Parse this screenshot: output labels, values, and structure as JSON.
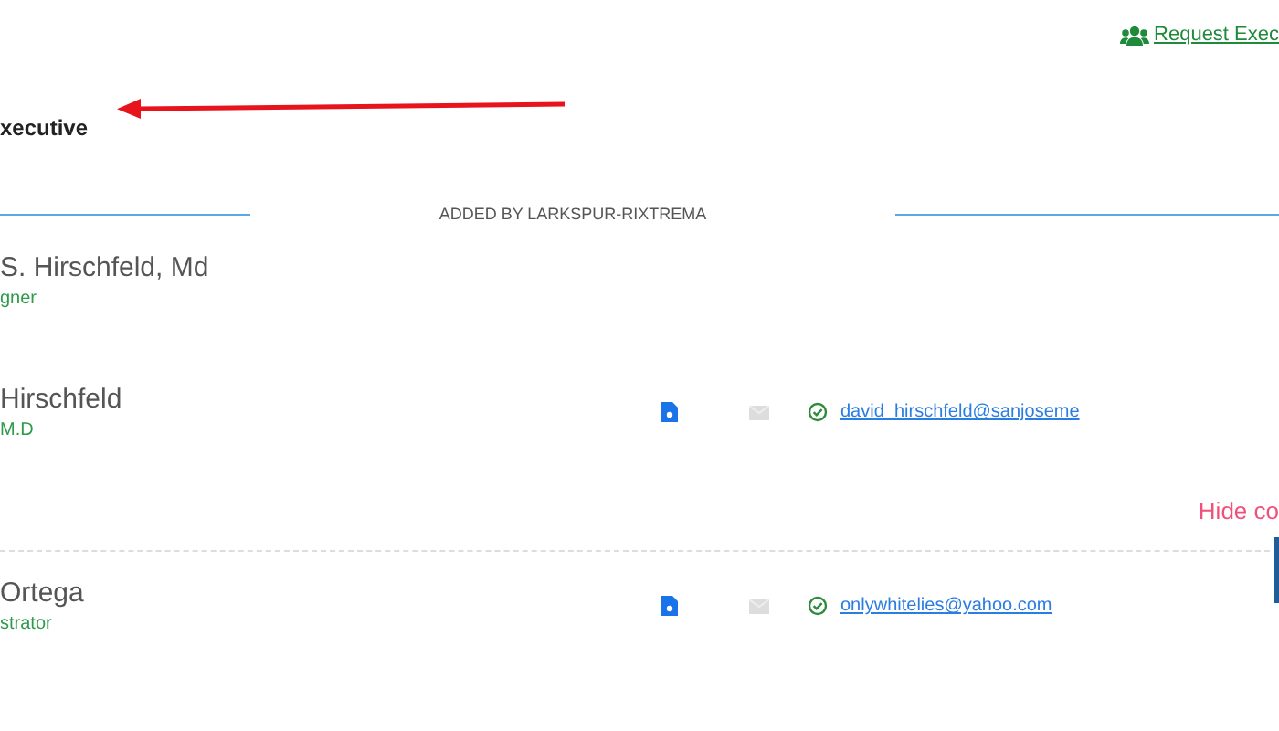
{
  "request_link": {
    "label": "Request Exec"
  },
  "heading": {
    "title": "xecutive"
  },
  "section": {
    "label": "ADDED BY LARKSPUR-RIXTREMA"
  },
  "contacts": [
    {
      "name": "S. Hirschfeld, Md",
      "role": "gner"
    },
    {
      "name": "Hirschfeld",
      "role": "M.D",
      "email": "david_hirschfeld@sanjoseme",
      "toggle": "Hide co"
    },
    {
      "name": "Ortega",
      "role": "strator",
      "email": "onlywhitelies@yahoo.com"
    }
  ]
}
